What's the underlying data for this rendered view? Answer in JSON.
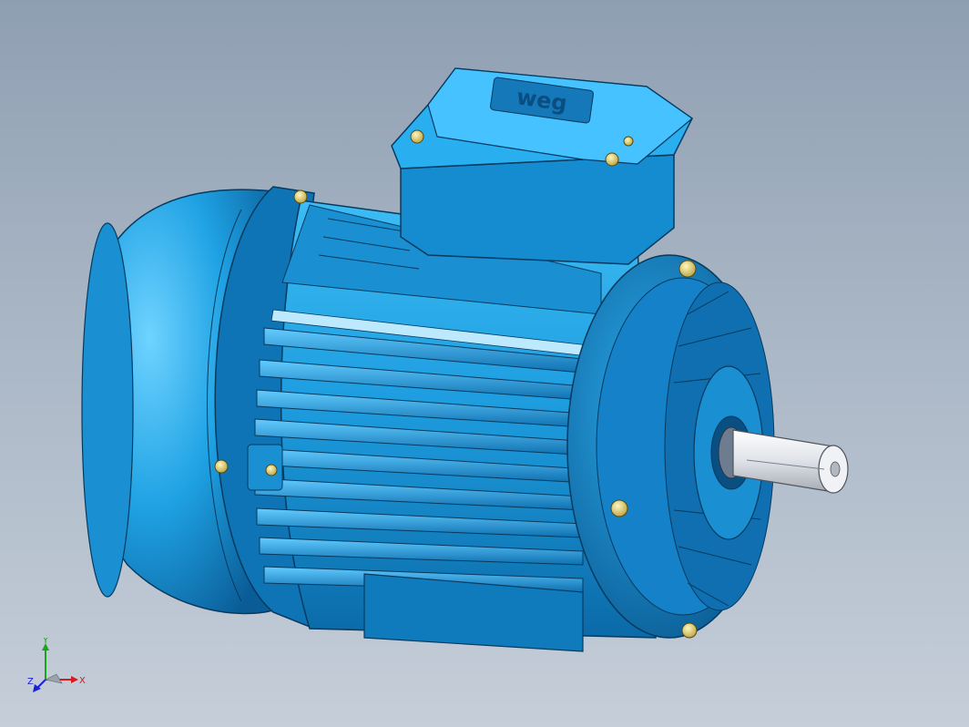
{
  "model": {
    "name": "weg",
    "brand_text": "weg",
    "body_color": "#1f9fe0",
    "body_shadow": "#0b5e97",
    "body_highlight": "#6fd3ff",
    "shaft_color": "#e3e5ea",
    "bolt_color": "#e8d779"
  },
  "triad": {
    "x_label": "X",
    "y_label": "Y",
    "z_label": "Z",
    "x_color": "#d81a1a",
    "y_color": "#1aa61a",
    "z_color": "#1a22d8"
  },
  "viewport": {
    "background_top": "#8f9fb2",
    "background_bottom": "#c5ced9"
  }
}
